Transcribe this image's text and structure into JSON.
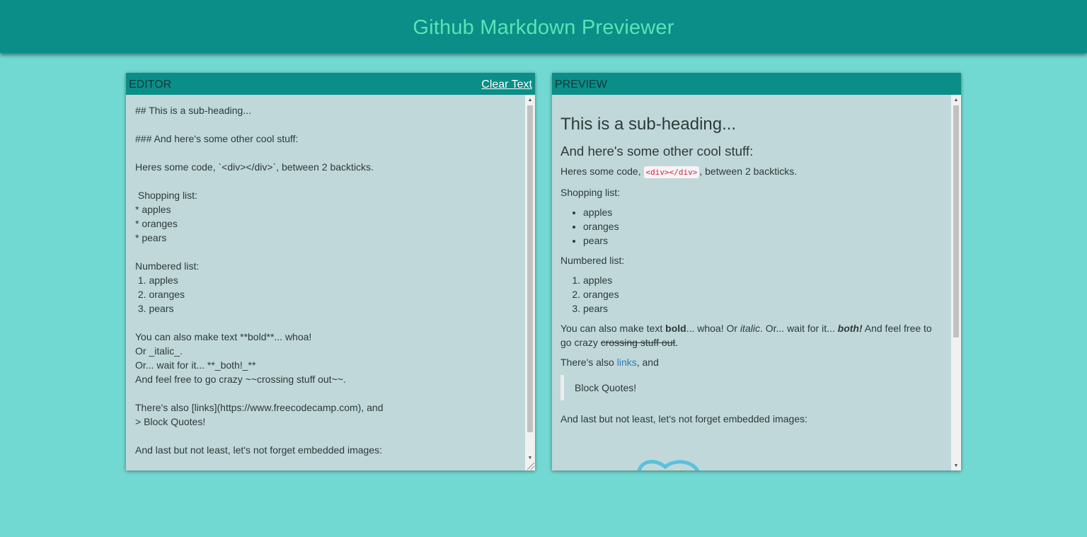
{
  "header": {
    "title": "Github Markdown Previewer"
  },
  "editor": {
    "title": "EDITOR",
    "clear_label": "Clear Text",
    "text": "## This is a sub-heading...\n\n### And here's some other cool stuff:\n\nHeres some code, `<div></div>`, between 2 backticks.\n\n Shopping list:\n* apples\n* oranges\n* pears\n\nNumbered list:\n 1. apples\n 2. oranges\n 3. pears\n\nYou can also make text **bold**... whoa!\nOr _italic_.\nOr... wait for it... **_both!_**\nAnd feel free to go crazy ~~crossing stuff out~~.\n\nThere's also [links](https://www.freecodecamp.com), and\n> Block Quotes!\n\nAnd last but not least, let's not forget embedded images:"
  },
  "preview": {
    "title": "PREVIEW",
    "h2": "This is a sub-heading...",
    "h3": "And here's some other cool stuff:",
    "code_line": {
      "before": "Heres some code, ",
      "code": "<div></div>",
      "after": ", between 2 backticks."
    },
    "shopping_label": "Shopping list:",
    "shopping_items": [
      "apples",
      "oranges",
      "pears"
    ],
    "numbered_label": "Numbered list:",
    "numbered_items": [
      "apples",
      "oranges",
      "pears"
    ],
    "formatting": {
      "t1": "You can also make text ",
      "bold": "bold",
      "t2": "... whoa! Or ",
      "italic": "italic",
      "t3": ". Or... wait for it... ",
      "both": "both!",
      "t4": " And feel free to go crazy ",
      "strike": "crossing stuff out",
      "t5": "."
    },
    "links_line": {
      "before": "There's also ",
      "link": "links",
      "after": ", and"
    },
    "blockquote": "Block Quotes!",
    "last_line": "And last but not least, let's not forget embedded images:"
  },
  "colors": {
    "background": "#72d9d2",
    "header_bg": "#0a8e87",
    "title_text": "#5ae3b6",
    "panel_bg": "#c0d8d9",
    "link": "#337ab7",
    "code_text": "#c7254e"
  }
}
